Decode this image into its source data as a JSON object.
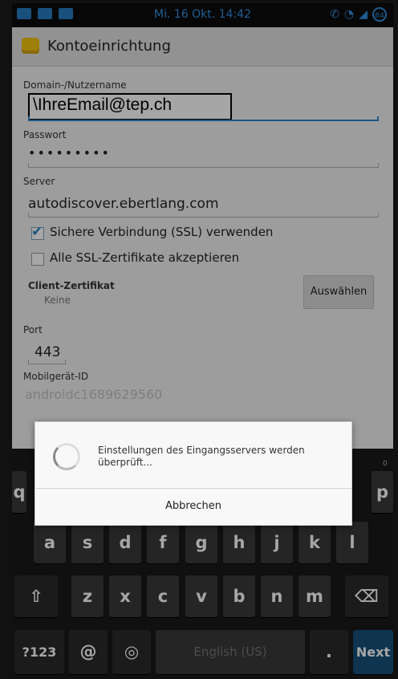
{
  "status_bar": {
    "time": "Mi. 16 Okt. 14:42",
    "battery": "84",
    "left_icons": [
      "keyboard-icon",
      "image-icon",
      "app-icon"
    ],
    "right_icons": [
      "vibrate-icon",
      "wifi-icon",
      "signal-icon",
      "battery-icon"
    ],
    "accent_color": "#2f8fe0"
  },
  "action_bar": {
    "title": "Kontoeinrichtung",
    "icon": "mail-envelope-icon"
  },
  "form": {
    "domain_label": "Domain-/Nutzername",
    "domain_value": "\\IhreEmail@tep.ch",
    "password_label": "Passwort",
    "password_value": "•••••••••",
    "server_label": "Server",
    "server_value": "autodiscover.ebertlang.com",
    "ssl_label": "Sichere Verbindung (SSL) verwenden",
    "ssl_checked": true,
    "accept_certs_label": "Alle SSL-Zertifikate akzeptieren",
    "accept_certs_checked": false,
    "client_cert_label": "Client-Zertifikat",
    "client_cert_value": "Keine",
    "select_button": "Auswählen",
    "port_label": "Port",
    "port_value": "443",
    "device_id_label": "Mobilgerät-ID",
    "device_id_value": "androidc1689629560"
  },
  "dialog": {
    "message": "Einstellungen des Eingangsservers werden überprüft...",
    "cancel_button": "Abbrechen"
  },
  "keyboard": {
    "row1_visible": [
      "q",
      "p"
    ],
    "row1_hint": "0",
    "row2": [
      "a",
      "s",
      "d",
      "f",
      "g",
      "h",
      "j",
      "k",
      "l"
    ],
    "row3": [
      "z",
      "x",
      "c",
      "v",
      "b",
      "n",
      "m"
    ],
    "symbols_key": "?123",
    "at_key": "@",
    "space_label": "English (US)",
    "period_key": ".",
    "next_key": "Next",
    "next_color": "#16507a"
  }
}
